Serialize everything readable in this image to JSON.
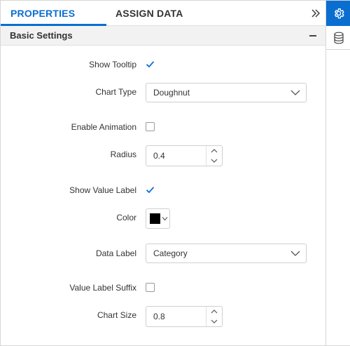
{
  "tabs": {
    "properties": "PROPERTIES",
    "assign_data": "ASSIGN DATA"
  },
  "section": {
    "title": "Basic Settings"
  },
  "rows": {
    "show_tooltip": {
      "label": "Show Tooltip",
      "checked": true
    },
    "chart_type": {
      "label": "Chart Type",
      "value": "Doughnut"
    },
    "enable_animation": {
      "label": "Enable Animation",
      "checked": false
    },
    "radius": {
      "label": "Radius",
      "value": "0.4"
    },
    "show_value_label": {
      "label": "Show Value Label",
      "checked": true
    },
    "color": {
      "label": "Color",
      "value": "#000000"
    },
    "data_label": {
      "label": "Data Label",
      "value": "Category"
    },
    "value_label_suffix": {
      "label": "Value Label Suffix",
      "checked": false
    },
    "chart_size": {
      "label": "Chart Size",
      "value": "0.8"
    }
  },
  "colors": {
    "accent": "#0a6ed1",
    "checkbox_checked": "#0a6ed1"
  },
  "icons": {
    "collapse": "double-chevron-right-icon",
    "settings": "gear-icon",
    "data": "database-icon",
    "section_toggle": "minus-icon"
  }
}
